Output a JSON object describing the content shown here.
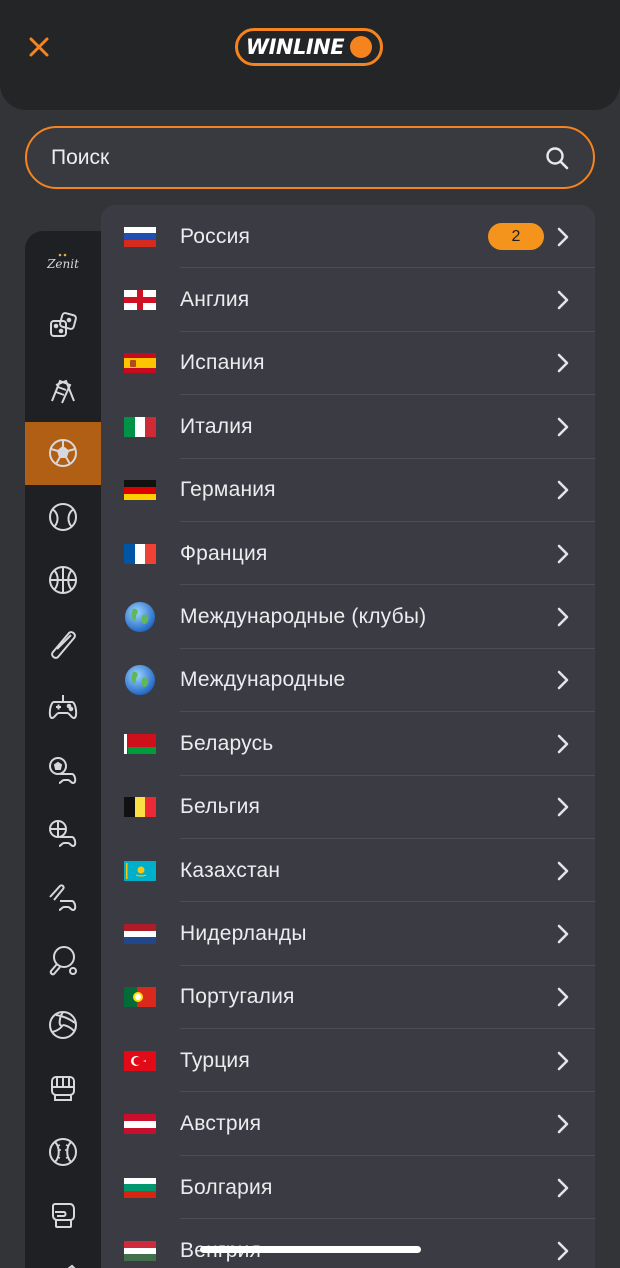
{
  "header": {
    "logo_text": "WINLINE",
    "brand_color": "#f5841f"
  },
  "search": {
    "placeholder": "Поиск"
  },
  "sports": [
    {
      "icon": "zenit-logo-icon"
    },
    {
      "icon": "dice-icon"
    },
    {
      "icon": "racing-flags-icon"
    },
    {
      "icon": "soccer-ball-icon",
      "active": true
    },
    {
      "icon": "tennis-ball-icon"
    },
    {
      "icon": "basketball-icon"
    },
    {
      "icon": "hockey-puck-icon"
    },
    {
      "icon": "gamepad-icon"
    },
    {
      "icon": "esports-soccer-icon"
    },
    {
      "icon": "esports-basketball-icon"
    },
    {
      "icon": "esports-hockey-icon"
    },
    {
      "icon": "table-tennis-icon"
    },
    {
      "icon": "volleyball-icon"
    },
    {
      "icon": "boxing-glove-icon"
    },
    {
      "icon": "baseball-icon"
    },
    {
      "icon": "mma-glove-icon"
    },
    {
      "icon": "badminton-icon"
    }
  ],
  "countries": [
    {
      "name": "Россия",
      "flag": "russia",
      "badge": "2"
    },
    {
      "name": "Англия",
      "flag": "england"
    },
    {
      "name": "Испания",
      "flag": "spain"
    },
    {
      "name": "Италия",
      "flag": "italy"
    },
    {
      "name": "Германия",
      "flag": "germany"
    },
    {
      "name": "Франция",
      "flag": "france"
    },
    {
      "name": "Международные (клубы)",
      "flag": "globe"
    },
    {
      "name": "Международные",
      "flag": "globe"
    },
    {
      "name": "Беларусь",
      "flag": "belarus"
    },
    {
      "name": "Бельгия",
      "flag": "belgium"
    },
    {
      "name": "Казахстан",
      "flag": "kazakhstan"
    },
    {
      "name": "Нидерланды",
      "flag": "netherlands"
    },
    {
      "name": "Португалия",
      "flag": "portugal"
    },
    {
      "name": "Турция",
      "flag": "turkey"
    },
    {
      "name": "Австрия",
      "flag": "austria"
    },
    {
      "name": "Болгария",
      "flag": "bulgaria"
    },
    {
      "name": "Венгрия",
      "flag": "hungary"
    }
  ]
}
